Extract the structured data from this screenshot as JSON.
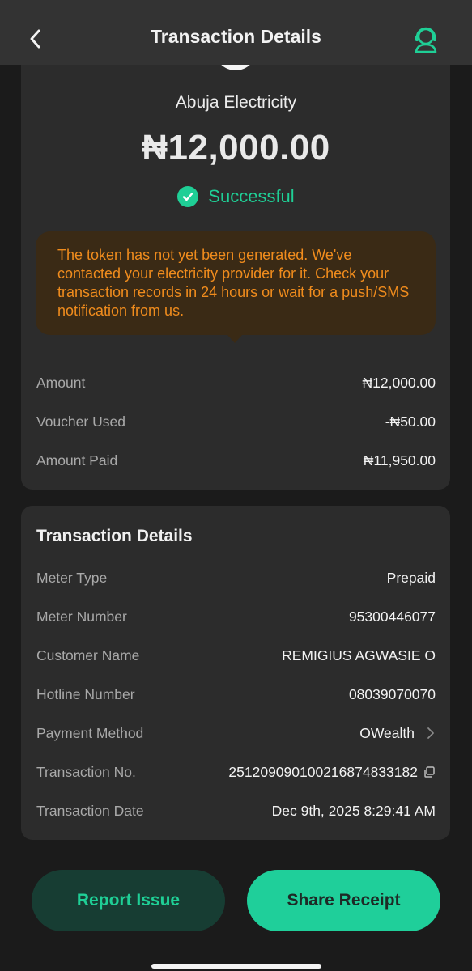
{
  "header": {
    "title": "Transaction Details",
    "back_icon": "chevron-left-icon",
    "support_icon": "customer-support-icon"
  },
  "summary": {
    "merchant": "Abuja Electricity",
    "amount": "₦12,000.00",
    "status": "Successful",
    "notice": "The token has not yet been generated. We've contacted your electricity provider for it. Check your transaction records in 24 hours or wait for a push/SMS notification from us.",
    "rows": [
      {
        "label": "Amount",
        "value": "₦12,000.00"
      },
      {
        "label": "Voucher Used",
        "value": "-₦50.00"
      },
      {
        "label": "Amount Paid",
        "value": "₦11,950.00"
      }
    ]
  },
  "details": {
    "title": "Transaction Details",
    "rows": [
      {
        "label": "Meter Type",
        "value": "Prepaid"
      },
      {
        "label": "Meter Number",
        "value": "95300446077"
      },
      {
        "label": "Customer Name",
        "value": "REMIGIUS AGWASIE O"
      },
      {
        "label": "Hotline Number",
        "value": "08039070070"
      },
      {
        "label": "Payment Method",
        "value": "OWealth"
      },
      {
        "label": "Transaction No.",
        "value": "251209090100216874833182"
      },
      {
        "label": "Transaction Date",
        "value": "Dec 9th, 2025 8:29:41 AM"
      }
    ]
  },
  "actions": {
    "report": "Report Issue",
    "share": "Share Receipt"
  },
  "colors": {
    "accent": "#1fcf96",
    "warning_text": "#f08c1d",
    "warning_bg": "#3a2a15"
  }
}
